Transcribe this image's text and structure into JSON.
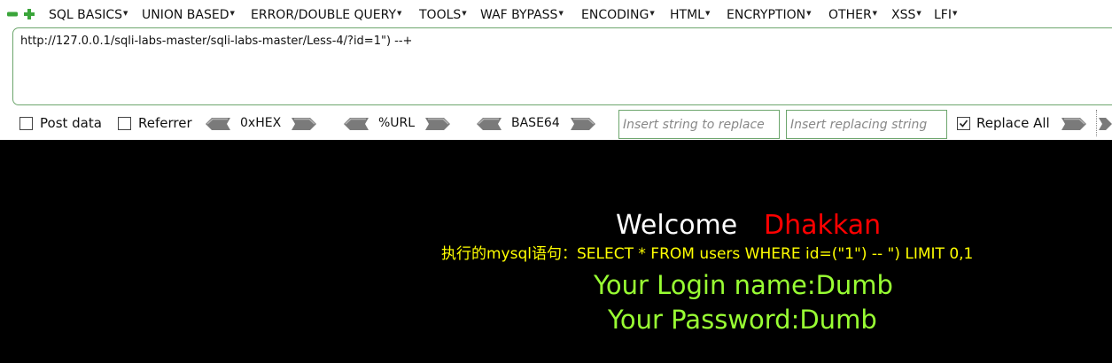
{
  "toolbar": {
    "controls": {
      "minus_icon": "minus-icon",
      "plus_icon": "plus-icon"
    },
    "menu": [
      {
        "label": "SQL BASICS"
      },
      {
        "label": "UNION BASED"
      },
      {
        "label": "ERROR/DOUBLE QUERY"
      },
      {
        "label": "TOOLS"
      },
      {
        "label": "WAF BYPASS"
      },
      {
        "label": "ENCODING"
      },
      {
        "label": "HTML"
      },
      {
        "label": "ENCRYPTION"
      },
      {
        "label": "OTHER"
      },
      {
        "label": "XSS"
      },
      {
        "label": "LFI"
      }
    ],
    "url_value": "http://127.0.0.1/sqli-labs-master/sqli-labs-master/Less-4/?id=1\") --+",
    "options": {
      "post_data": "Post data",
      "referrer": "Referrer",
      "hex": "0xHEX",
      "url_encode": "%URL",
      "base64": "BASE64",
      "replace_placeholder": "Insert string to replace",
      "replacing_placeholder": "Insert replacing string",
      "replace_all": "Replace All"
    },
    "colors": {
      "border_green": "#6da66d",
      "arrow_gray": "#7a7a7a"
    }
  },
  "page": {
    "welcome": "Welcome",
    "name": "Dhakkan",
    "query": "执行的mysql语句：SELECT * FROM users WHERE id=(\"1\") -- \") LIMIT 0,1",
    "login": "Your Login name:Dumb",
    "password": "Your Password:Dumb",
    "colors": {
      "background": "#000000",
      "welcome": "#ffffff",
      "name": "#ff0000",
      "query": "#ffff00",
      "result": "#99ff33"
    }
  }
}
